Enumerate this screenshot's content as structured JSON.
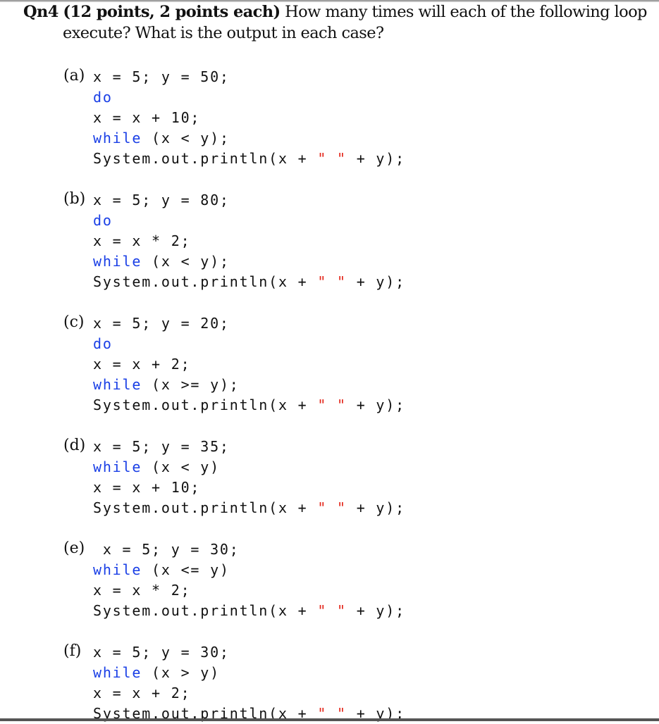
{
  "question": {
    "number": "Qn4",
    "points": "(12 points, 2 points each)",
    "prompt_line1": "How many times will each of the following loop",
    "prompt_line2": "execute? What is the output in each case?"
  },
  "colors": {
    "keyword": "#1a3fe6",
    "string": "#e3261a",
    "text": "#111111"
  },
  "parts": [
    {
      "label": "(a)",
      "lines": [
        [
          {
            "t": "x = 5; y = 50;",
            "k": "plain"
          }
        ],
        [
          {
            "t": "do",
            "k": "kw"
          }
        ],
        [
          {
            "t": "x = x + 10;",
            "k": "plain"
          }
        ],
        [
          {
            "t": "while",
            "k": "kw"
          },
          {
            "t": " (x < y);",
            "k": "plain"
          }
        ],
        [
          {
            "t": "System.out.println(x + ",
            "k": "plain"
          },
          {
            "t": "\" \"",
            "k": "str"
          },
          {
            "t": " + y);",
            "k": "plain"
          }
        ]
      ]
    },
    {
      "label": "(b)",
      "lines": [
        [
          {
            "t": "x = 5; y = 80;",
            "k": "plain"
          }
        ],
        [
          {
            "t": "do",
            "k": "kw"
          }
        ],
        [
          {
            "t": "x = x * 2;",
            "k": "plain"
          }
        ],
        [
          {
            "t": "while",
            "k": "kw"
          },
          {
            "t": " (x < y);",
            "k": "plain"
          }
        ],
        [
          {
            "t": "System.out.println(x + ",
            "k": "plain"
          },
          {
            "t": "\" \"",
            "k": "str"
          },
          {
            "t": " + y);",
            "k": "plain"
          }
        ]
      ]
    },
    {
      "label": "(c)",
      "lines": [
        [
          {
            "t": "x = 5; y = 20;",
            "k": "plain"
          }
        ],
        [
          {
            "t": "do",
            "k": "kw"
          }
        ],
        [
          {
            "t": "x = x + 2;",
            "k": "plain"
          }
        ],
        [
          {
            "t": "while",
            "k": "kw"
          },
          {
            "t": " (x >= y);",
            "k": "plain"
          }
        ],
        [
          {
            "t": "System.out.println(x + ",
            "k": "plain"
          },
          {
            "t": "\" \"",
            "k": "str"
          },
          {
            "t": " + y);",
            "k": "plain"
          }
        ]
      ]
    },
    {
      "label": "(d)",
      "lines": [
        [
          {
            "t": "x = 5; y = 35;",
            "k": "plain"
          }
        ],
        [
          {
            "t": "while",
            "k": "kw"
          },
          {
            "t": " (x < y)",
            "k": "plain"
          }
        ],
        [
          {
            "t": "x = x + 10;",
            "k": "plain"
          }
        ],
        [
          {
            "t": "System.out.println(x + ",
            "k": "plain"
          },
          {
            "t": "\" \"",
            "k": "str"
          },
          {
            "t": " + y);",
            "k": "plain"
          }
        ]
      ]
    },
    {
      "label": "(e)",
      "lines": [
        [
          {
            "t": " x = 5; y = 30;",
            "k": "plain"
          }
        ],
        [
          {
            "t": "while",
            "k": "kw"
          },
          {
            "t": " (x <= y)",
            "k": "plain"
          }
        ],
        [
          {
            "t": "x = x * 2;",
            "k": "plain"
          }
        ],
        [
          {
            "t": "System.out.println(x + ",
            "k": "plain"
          },
          {
            "t": "\" \"",
            "k": "str"
          },
          {
            "t": " + y);",
            "k": "plain"
          }
        ]
      ]
    },
    {
      "label": "(f)",
      "lines": [
        [
          {
            "t": "x = 5; y = 30;",
            "k": "plain"
          }
        ],
        [
          {
            "t": "while",
            "k": "kw"
          },
          {
            "t": " (x > y)",
            "k": "plain"
          }
        ],
        [
          {
            "t": "x = x + 2;",
            "k": "plain"
          }
        ],
        [
          {
            "t": "System.out.println(x + ",
            "k": "plain"
          },
          {
            "t": "\" \"",
            "k": "str"
          },
          {
            "t": " + y);",
            "k": "plain"
          }
        ]
      ]
    }
  ]
}
